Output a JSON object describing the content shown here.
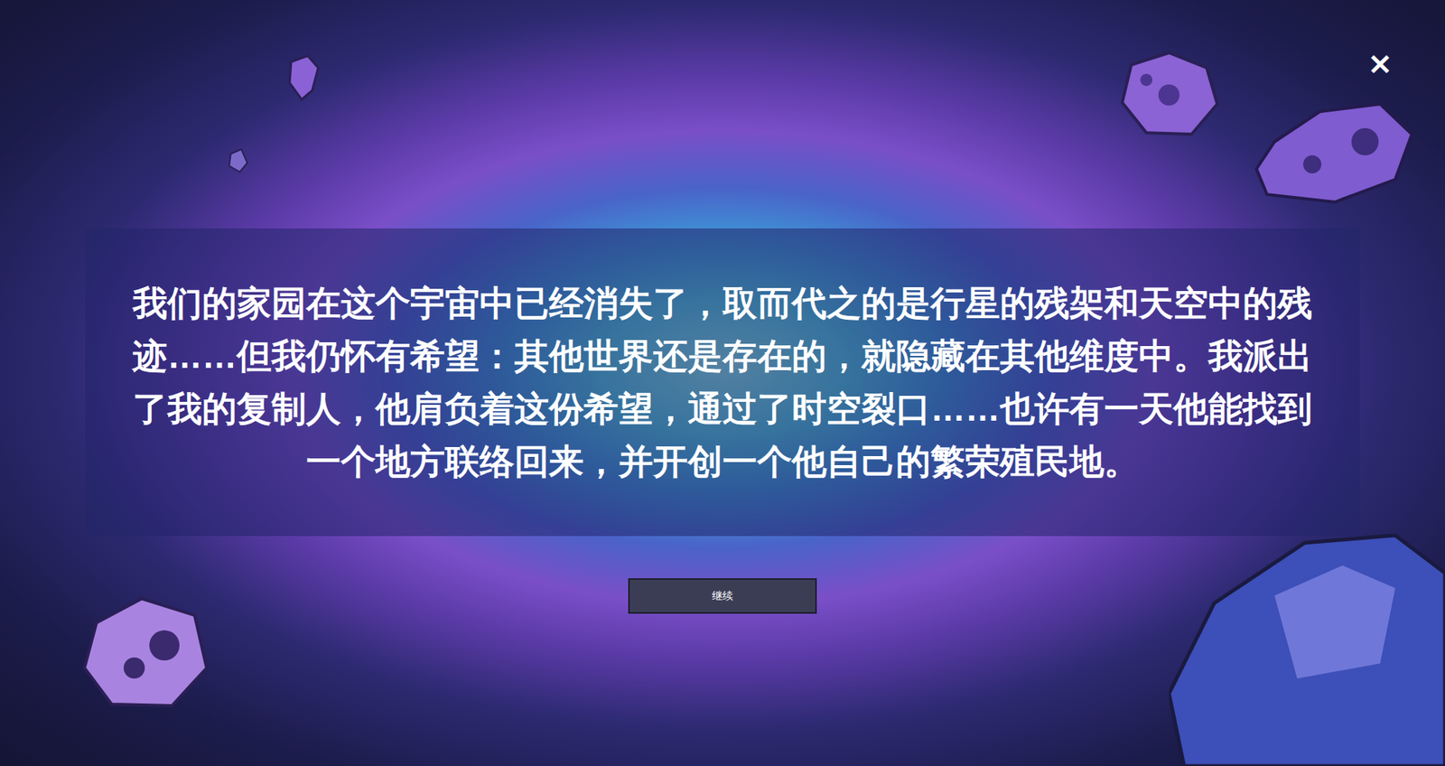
{
  "dialog": {
    "close": "✕",
    "text": "我们的家园在这个宇宙中已经消失了，取而代之的是行星的残架和天空中的残迹……但我仍怀有希望：其他世界还是存在的，就隐藏在其他维度中。我派出了我的复制人，他肩负着这份希望，通过了时空裂口……也许有一天他能找到一个地方联络回来，并开创一个他自己的繁荣殖民地。",
    "button": "继续"
  }
}
